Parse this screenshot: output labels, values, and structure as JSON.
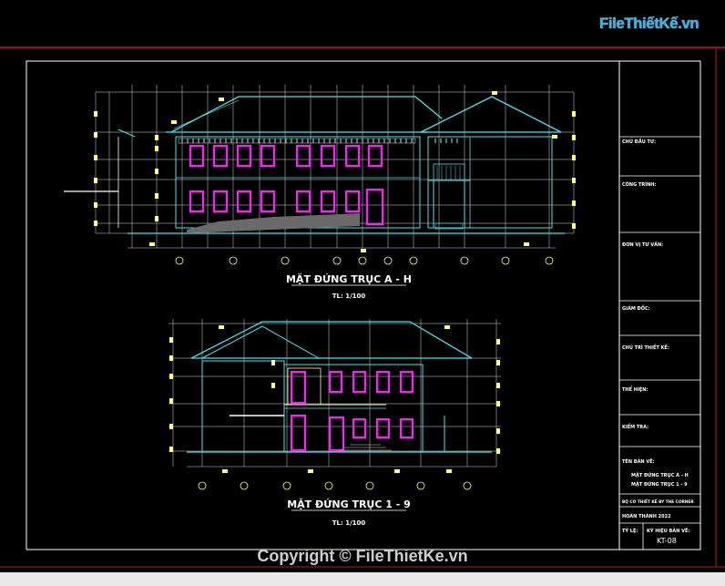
{
  "watermark": {
    "logo_text": "FileThiếtKế.vn",
    "copyright": "Copyright © FileThietKe.vn"
  },
  "drawing": {
    "elevation_1": {
      "title": "MẶT ĐỨNG TRỤC A - H",
      "scale": "TL: 1/100"
    },
    "elevation_2": {
      "title": "MẶT ĐỨNG TRỤC 1 - 9",
      "scale": "TL: 1/100"
    }
  },
  "title_block": {
    "owner": "CHỦ ĐẦU TƯ:",
    "project": "CÔNG TRÌNH:",
    "consultant": "ĐƠN VỊ TƯ VẤN:",
    "director": "GIÁM ĐỐC:",
    "lead_designer": "CHỦ TRÌ THIẾT KẾ:",
    "drafter": "THỂ HIỆN:",
    "checker": "KIỂM TRA:",
    "sheet_name_label": "TÊN BẢN VẼ:",
    "sheet_name_1": "MẶT ĐỨNG TRỤC A - H",
    "sheet_name_2": "MẶT ĐỨNG TRỤC 1 - 9",
    "design_note": "BỘ CƠ THIẾT KẾ BY THE CORNER",
    "completion": "HOÀN THÀNH 2022",
    "ratio_label": "TỶ LỆ:",
    "sheet_no_label": "KÝ HIỆU BẢN VẼ:",
    "sheet_no": "KT-08"
  },
  "colors": {
    "background": "#000000",
    "frame": "#ffffff",
    "border_red": "#c8141e",
    "outline_cyan": "#3fe6ee",
    "window_magenta": "#ff1cff",
    "grid_white": "#d8d8d8",
    "tag_yellow": "#ffff80"
  }
}
